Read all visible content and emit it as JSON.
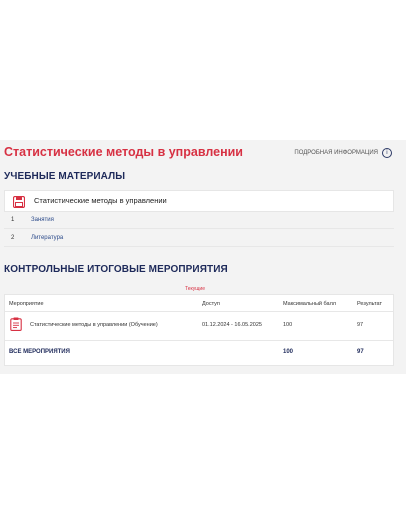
{
  "course": {
    "title": "Статистические методы в управлении",
    "info_link": "ПОДРОБНАЯ ИНФОРМАЦИЯ",
    "info_icon": "i"
  },
  "materials": {
    "heading": "УЧЕБНЫЕ МАТЕРИАЛЫ",
    "card_title": "Статистические методы в управлении",
    "card_icon": "save-icon",
    "items": [
      {
        "num": "1",
        "label": "Занятия"
      },
      {
        "num": "2",
        "label": "Литература"
      }
    ]
  },
  "events": {
    "heading": "КОНТРОЛЬНЫЕ ИТОГОВЫЕ МЕРОПРИЯТИЯ",
    "current_badge": "Текущие",
    "columns": {
      "event": "Мероприятие",
      "access": "Доступ",
      "max_score": "Максимальный балл",
      "result": "Результат"
    },
    "rows": [
      {
        "name": "Статистические методы в управлении (Обучение)",
        "access": "01.12.2024 - 16.05.2025",
        "max_score": "100",
        "result": "97",
        "icon": "clipboard-icon"
      }
    ],
    "total": {
      "label": "ВСЕ МЕРОПРИЯТИЯ",
      "max_score": "100",
      "result": "97"
    }
  },
  "colors": {
    "accent_red": "#d73143",
    "heading_navy": "#1e2a5a",
    "panel_gray": "#f3f3f3"
  }
}
